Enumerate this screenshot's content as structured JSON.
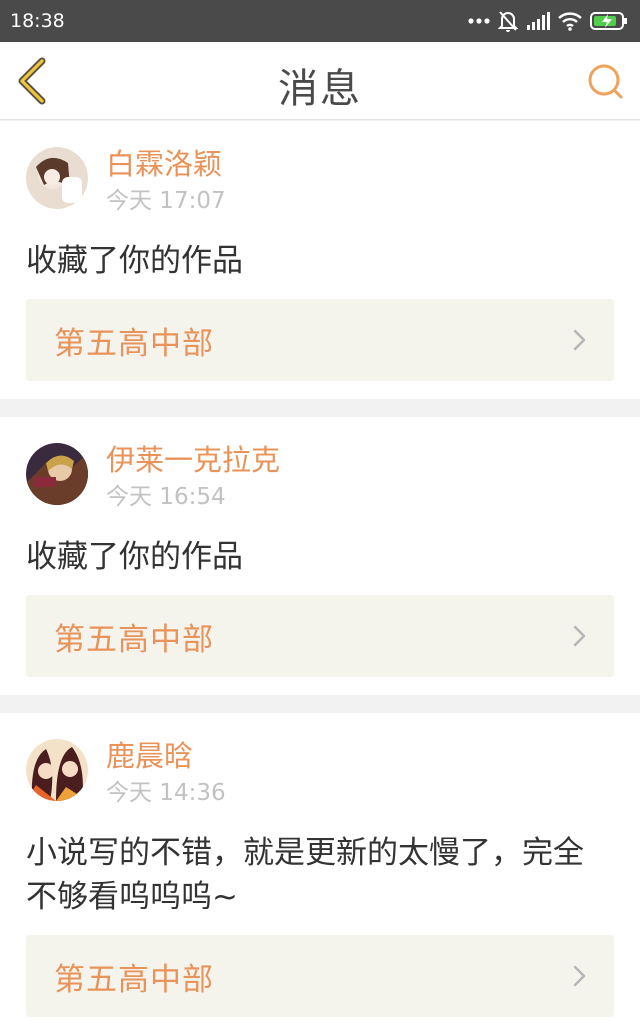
{
  "status_bar": {
    "time": "18:38"
  },
  "nav": {
    "title": "消息"
  },
  "colors": {
    "accent": "#e8935a",
    "page_bg": "#f2f2f2",
    "link_bg": "#f4f3ec"
  },
  "messages": [
    {
      "user": "白霖洛颖",
      "time": "今天 17:07",
      "text": "收藏了你的作品",
      "work": "第五高中部"
    },
    {
      "user": "伊莱一克拉克",
      "time": "今天 16:54",
      "text": "收藏了你的作品",
      "work": "第五高中部"
    },
    {
      "user": "鹿晨晗",
      "time": "今天 14:36",
      "text": "小说写的不错，就是更新的太慢了，完全不够看呜呜呜~",
      "work": "第五高中部"
    }
  ],
  "icons": [
    "back-arrow-icon",
    "search-icon",
    "chevron-right-icon",
    "dots-icon",
    "bell-off-icon",
    "signal-icon",
    "wifi-icon",
    "battery-icon"
  ]
}
